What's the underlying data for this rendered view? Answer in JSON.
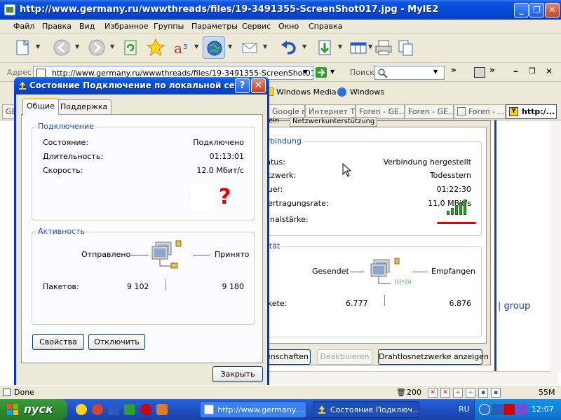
{
  "browser": {
    "title": "http://www.germany.ru/wwwthreads/files/19-3491355-ScreenShot017.jpg - MyIE2",
    "menu": [
      "Файл",
      "Правка",
      "Вид",
      "Избранное",
      "Группы",
      "Параметры",
      "Сервис",
      "Окно",
      "Справка"
    ],
    "address_label": "Адрес",
    "address_value": "http://www.germany.ru/wwwthreads/files/19-3491355-ScreenShot017.;",
    "search_label": "Поиск",
    "links": [
      "Windows Media",
      "Windows"
    ],
    "tabs": [
      "GE",
      "Google ru",
      "Интернет TV",
      "Foren - GE...",
      "Foren - GE...",
      "Foren - ...",
      "http:/..."
    ],
    "status_text": "Done",
    "status_count": "200",
    "status_mem": "55M",
    "group_text": "| group"
  },
  "bg_dialog": {
    "tab_label": "Netzwerkunterstützung",
    "tab_partial": "ein",
    "connection_legend": "Verbindung",
    "rows": [
      {
        "label": "tatus:",
        "value": "Verbindung hergestellt"
      },
      {
        "label": "etzwerk:",
        "value": "Todesstern"
      },
      {
        "label": "auer:",
        "value": "01:22:30"
      },
      {
        "label": "bertragungsrate:",
        "value": "11,0 MBit/s"
      },
      {
        "label": "ignalstärke:",
        "value": ""
      }
    ],
    "signal_strength_percent": 100,
    "activity_legend": "tivität",
    "sent_label": "Gesendet",
    "received_label": "Empfangen",
    "packets_label": "akete:",
    "packets_sent": "6.777",
    "packets_received": "6.876",
    "wireless_badge": "(((•)))",
    "buttons": [
      "enschaften",
      "Deaktivieren",
      "Drahtlosnetzwerke anzeigen"
    ]
  },
  "dialog": {
    "title": "Состояние Подключение по локальной сети",
    "help_label": "?",
    "close_label": "✕",
    "tabs": [
      "Общие",
      "Поддержка"
    ],
    "connection": {
      "legend": "Подключение",
      "rows": [
        {
          "label": "Состояние:",
          "value": "Подключено"
        },
        {
          "label": "Длительность:",
          "value": "01:13:01"
        },
        {
          "label": "Скорость:",
          "value": "12.0 Мбит/с"
        }
      ],
      "annotation": "?"
    },
    "activity": {
      "legend": "Активность",
      "sent_label": "Отправлено",
      "received_label": "Принято",
      "packets_label": "Пакетов:",
      "packets_sent": "9 102",
      "packets_received": "9 180"
    },
    "buttons": {
      "properties": "Свойства",
      "disable": "Отключить",
      "close": "Закрыть"
    }
  },
  "taskbar": {
    "start_label": "пуск",
    "tasks": [
      "http://www.germany....",
      "Состояние Подключ..."
    ],
    "lang": "RU",
    "clock": "12:07"
  },
  "colors": {
    "xp_blue": "#0a55e3",
    "start_green": "#2f8a2f",
    "legend_blue": "#1f4ab5",
    "annotation_red": "#e00000",
    "signal_green": "#2e9e2e"
  }
}
